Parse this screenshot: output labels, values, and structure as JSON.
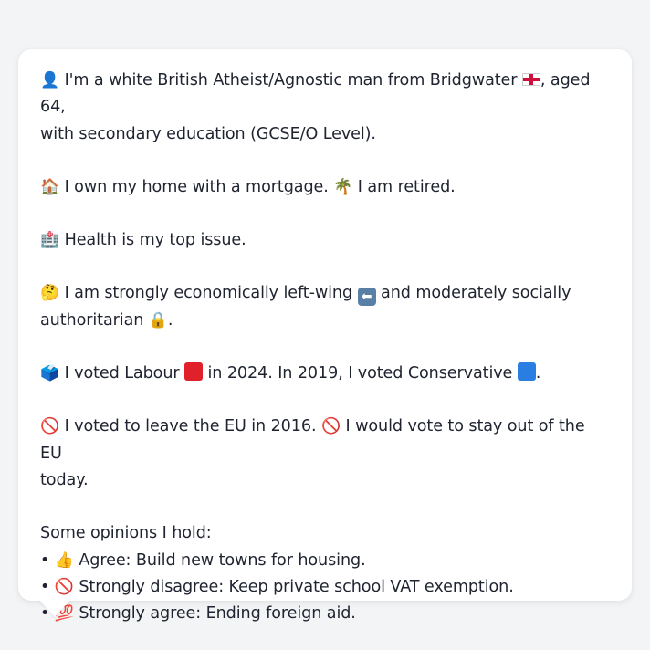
{
  "profile": {
    "intro_icon": "👤",
    "intro_text_1": " I'm a white British Atheist/Agnostic man from Bridgwater ",
    "intro_flag_icon": "england-flag-icon",
    "intro_text_2": ", aged 64,",
    "intro_text_3": "with secondary education (GCSE/O Level).",
    "home_icon": "🏠",
    "home_text": " I own my home with a mortgage. ",
    "retired_icon": "🌴",
    "retired_text": " I am retired.",
    "health_icon": "🏥",
    "health_text": " Health is my top issue.",
    "econ_icon": "🤔",
    "econ_text_1": " I am strongly economically left-wing ",
    "econ_arrow": "⬅",
    "econ_text_2": " and moderately socially",
    "econ_text_3": "authoritarian ",
    "lock_icon": "🔒",
    "econ_text_4": ".",
    "vote_icon": "🗳️",
    "vote_text_1": " I voted Labour ",
    "vote_text_2": " in 2024. In 2019, I voted Conservative ",
    "vote_text_3": ".",
    "eu_icon": "🚫",
    "eu_text_1": " I voted to leave the EU in 2016. ",
    "eu_icon_2": "🚫",
    "eu_text_2": " I would vote to stay out of the EU",
    "eu_text_3": "today.",
    "opinions_heading": "Some opinions I hold:",
    "opinions": [
      {
        "bullet": "•",
        "icon": "👍",
        "text": " Agree: Build new towns for housing."
      },
      {
        "bullet": "•",
        "icon": "🚫",
        "text": " Strongly disagree: Keep private school VAT exemption."
      },
      {
        "bullet": "•",
        "icon": "💯",
        "text": " Strongly agree: Ending foreign aid."
      }
    ]
  },
  "colors": {
    "labour_red": "#e0202a",
    "conservative_blue": "#2a7de1",
    "background": "#f3f4f6",
    "bubble": "#ffffff",
    "text": "#1f2430"
  }
}
